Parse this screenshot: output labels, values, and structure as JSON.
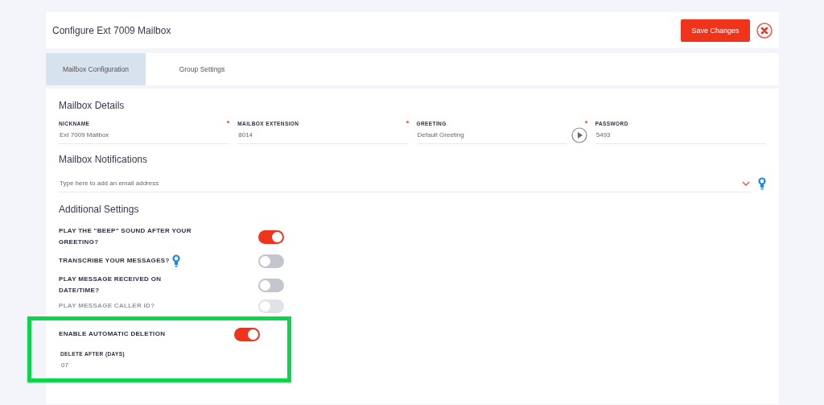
{
  "header": {
    "title": "Configure Ext 7009 Mailbox",
    "save_button": "Save Changes"
  },
  "tabs": [
    {
      "label": "Mailbox Configuration",
      "selected": true
    },
    {
      "label": "Group Settings",
      "selected": false
    }
  ],
  "mailbox_details": {
    "heading": "Mailbox Details",
    "fields": [
      {
        "kind": "text",
        "label": "NICKNAME",
        "value": "Ext 7009 Mailbox",
        "required": true
      },
      {
        "kind": "text",
        "label": "MAILBOX EXTENSION",
        "value": "8014",
        "required": true
      },
      {
        "kind": "play",
        "label": "GREETING",
        "value": "Default Greeting",
        "required": true
      },
      {
        "kind": "text",
        "label": "PASSWORD",
        "value": "5493",
        "required": false
      }
    ]
  },
  "notifications": {
    "heading": "Mailbox Notifications",
    "placeholder": "Type here to add an email address"
  },
  "additional": {
    "heading": "Additional Settings",
    "settings": [
      {
        "label": "PLAY THE \"BEEP\" SOUND AFTER YOUR GREETING?",
        "on": true,
        "hint": false
      },
      {
        "label": "TRANSCRIBE YOUR MESSAGES?",
        "on": false,
        "hint": true
      },
      {
        "label": "PLAY MESSAGE RECEIVED ON DATE/TIME?",
        "on": false,
        "hint": false
      },
      {
        "label": "PLAY MESSAGE CALLER ID?",
        "on": false,
        "hint": false
      },
      {
        "label": "ENABLE AUTOMATIC DELETION",
        "on": true,
        "hint": false
      }
    ],
    "delete_after": {
      "label": "DELETE AFTER (DAYS)",
      "value": "07"
    }
  }
}
